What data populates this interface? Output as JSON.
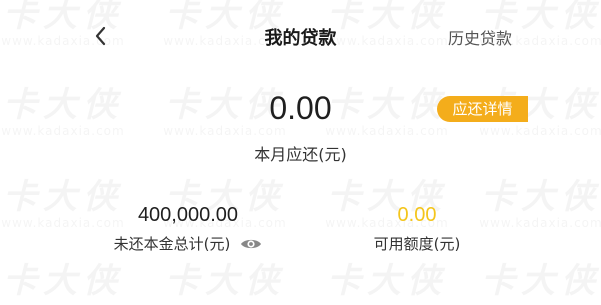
{
  "header": {
    "title": "我的贷款",
    "history_label": "历史贷款"
  },
  "repayment": {
    "amount": "0.00",
    "label": "本月应还(元)",
    "detail_button_label": "应还详情"
  },
  "stats": {
    "unpaid_principal_value": "400,000.00",
    "unpaid_principal_label": "未还本金总计(元)",
    "available_credit_value": "0.00",
    "available_credit_label": "可用额度(元)"
  },
  "watermark": {
    "logo_text": "卡大侠",
    "site_text": "www.kadaxia.com"
  },
  "colors": {
    "accent": "#f4ad1b",
    "available_credit": "#f4c51b"
  },
  "icons": {
    "back": "chevron-left-icon",
    "visibility": "eye-icon"
  }
}
